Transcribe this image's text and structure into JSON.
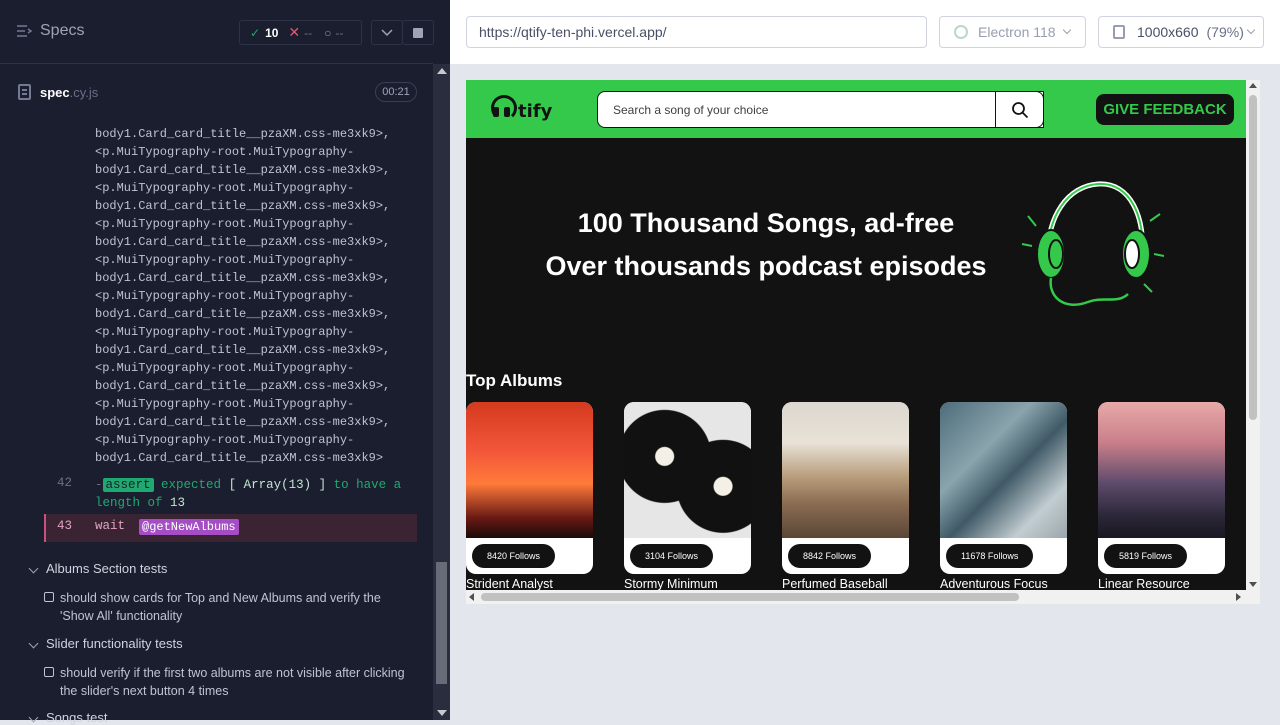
{
  "reporter": {
    "specs_label": "Specs",
    "stats": {
      "passed": "10",
      "failed": "--",
      "pending": "--"
    },
    "spec_file": {
      "name": "spec",
      "ext": ".cy.js",
      "duration": "00:21"
    },
    "code_lines": [
      "body1.Card_card_title__pzaXM.css-me3xk9>,",
      "<p.MuiTypography-root.MuiTypography-",
      "body1.Card_card_title__pzaXM.css-me3xk9>,",
      "<p.MuiTypography-root.MuiTypography-",
      "body1.Card_card_title__pzaXM.css-me3xk9>,",
      "<p.MuiTypography-root.MuiTypography-",
      "body1.Card_card_title__pzaXM.css-me3xk9>,",
      "<p.MuiTypography-root.MuiTypography-",
      "body1.Card_card_title__pzaXM.css-me3xk9>,",
      "<p.MuiTypography-root.MuiTypography-",
      "body1.Card_card_title__pzaXM.css-me3xk9>,",
      "<p.MuiTypography-root.MuiTypography-",
      "body1.Card_card_title__pzaXM.css-me3xk9>,",
      "<p.MuiTypography-root.MuiTypography-",
      "body1.Card_card_title__pzaXM.css-me3xk9>,",
      "<p.MuiTypography-root.MuiTypography-",
      "body1.Card_card_title__pzaXM.css-me3xk9>,",
      "<p.MuiTypography-root.MuiTypography-",
      "body1.Card_card_title__pzaXM.css-me3xk9>"
    ],
    "cmd42": {
      "num": "42",
      "dash": "-",
      "tag": "assert",
      "text1": "expected",
      "val": "[ Array(13) ]",
      "text2": "to have a",
      "text3": "length of",
      "val2": "13"
    },
    "cmd43": {
      "num": "43",
      "cmd": "wait",
      "alias": "@getNewAlbums"
    },
    "suites": [
      {
        "title": "Albums Section tests",
        "test": "should show cards for Top and New Albums and verify the 'Show All' functionality"
      },
      {
        "title": "Slider functionality tests",
        "test": "should verify if the first two albums are not visible after clicking the slider's next button 4 times"
      },
      {
        "title": "Songs test"
      }
    ]
  },
  "aut": {
    "url": "https://qtify-ten-phi.vercel.app/",
    "browser": "Electron 118",
    "viewport_size": "1000x660",
    "viewport_scale": "(79%)"
  },
  "app": {
    "logo_text": "tify",
    "search_placeholder": "Search a song of your choice",
    "feedback_label": "GIVE FEEDBACK",
    "hero_line1": "100 Thousand Songs, ad-free",
    "hero_line2": "Over thousands podcast episodes",
    "section_title": "Top Albums",
    "albums": [
      {
        "follows": "8420 Follows",
        "title": "Strident Analyst"
      },
      {
        "follows": "3104 Follows",
        "title": "Stormy Minimum"
      },
      {
        "follows": "8842 Follows",
        "title": "Perfumed Baseball"
      },
      {
        "follows": "11678 Follows",
        "title": "Adventurous Focus"
      },
      {
        "follows": "5819 Follows",
        "title": "Linear Resource"
      }
    ]
  },
  "colors": {
    "reporter_bg": "#1b1e2e",
    "app_green": "#34c94b",
    "app_bg": "#121212",
    "pass": "#1fa971",
    "fail": "#e45770",
    "alias": "#a54dc4"
  }
}
